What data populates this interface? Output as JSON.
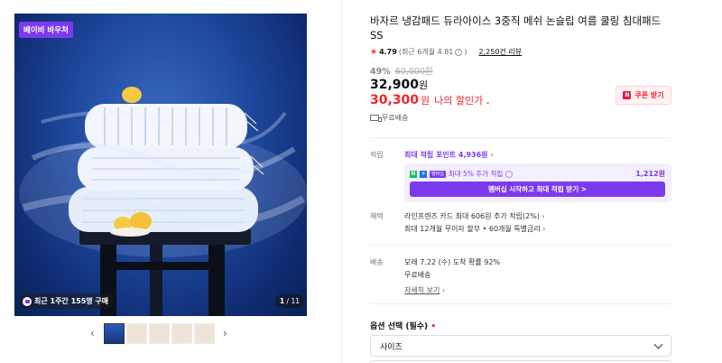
{
  "gallery": {
    "top_badge": "베이비 바우처",
    "purchase_badge": "최근 1주간 155명 구매",
    "counter_current": "1",
    "counter_total": "/ 11",
    "thumbnail_count": 5,
    "prev_arrow": "‹",
    "next_arrow": "›"
  },
  "product": {
    "title": "바자르 냉감패드 듀라아이스 3중직 메쉬 논슬립 여름 쿨링 침대패드 SS",
    "rating": "4.79",
    "rating_detail": "(최근 6개월 4.81",
    "rating_detail_end": ")",
    "review_count": "2,250건 리뷰",
    "discount_rate": "49%",
    "original_price": "60,000원",
    "price": "32,900",
    "price_unit": "원",
    "discounted_price": "30,300",
    "discounted_unit": "원",
    "discount_label": "나의 할인가",
    "coupon_button": "쿠폰 받기",
    "shipping_note": "무료배송"
  },
  "points": {
    "label": "적립",
    "max_points": "최대 적립 포인트 4,936원",
    "membership_text": "최대 5% 추가 적립",
    "membership_badge": "멤버십",
    "membership_amount": "1,212원",
    "membership_button": "멤버십 시작하고 최대 적립 받기 >"
  },
  "benefits": {
    "label": "혜택",
    "line1": "라인프렌즈 카드 최대 606원 추가 적립(2%)",
    "line2": "최대 12개월 무이자 할부 • 60개월 특별금리"
  },
  "delivery": {
    "label": "배송",
    "line1": "모레 7.22 (수) 도착 확률 92%",
    "line2": "무료배송",
    "details_link": "자세히 보기"
  },
  "options": {
    "label": "옵션 선택 (필수)",
    "required_mark": "•",
    "size_select": "사이즈"
  },
  "colors": {
    "accent_purple": "#7c3aed",
    "price_red": "#f5222d",
    "rating_star": "#f04438"
  }
}
